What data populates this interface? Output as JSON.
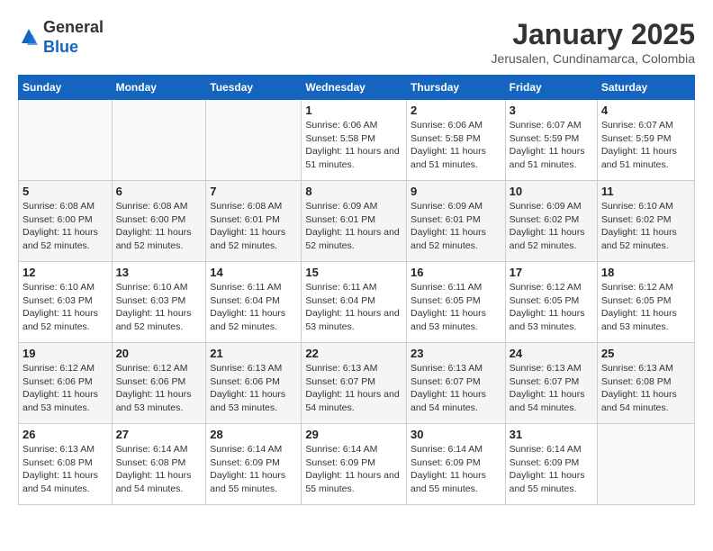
{
  "logo": {
    "general": "General",
    "blue": "Blue"
  },
  "title": "January 2025",
  "subtitle": "Jerusalen, Cundinamarca, Colombia",
  "days_of_week": [
    "Sunday",
    "Monday",
    "Tuesday",
    "Wednesday",
    "Thursday",
    "Friday",
    "Saturday"
  ],
  "weeks": [
    [
      {
        "day": "",
        "sunrise": "",
        "sunset": "",
        "daylight": ""
      },
      {
        "day": "",
        "sunrise": "",
        "sunset": "",
        "daylight": ""
      },
      {
        "day": "",
        "sunrise": "",
        "sunset": "",
        "daylight": ""
      },
      {
        "day": "1",
        "sunrise": "Sunrise: 6:06 AM",
        "sunset": "Sunset: 5:58 PM",
        "daylight": "Daylight: 11 hours and 51 minutes."
      },
      {
        "day": "2",
        "sunrise": "Sunrise: 6:06 AM",
        "sunset": "Sunset: 5:58 PM",
        "daylight": "Daylight: 11 hours and 51 minutes."
      },
      {
        "day": "3",
        "sunrise": "Sunrise: 6:07 AM",
        "sunset": "Sunset: 5:59 PM",
        "daylight": "Daylight: 11 hours and 51 minutes."
      },
      {
        "day": "4",
        "sunrise": "Sunrise: 6:07 AM",
        "sunset": "Sunset: 5:59 PM",
        "daylight": "Daylight: 11 hours and 51 minutes."
      }
    ],
    [
      {
        "day": "5",
        "sunrise": "Sunrise: 6:08 AM",
        "sunset": "Sunset: 6:00 PM",
        "daylight": "Daylight: 11 hours and 52 minutes."
      },
      {
        "day": "6",
        "sunrise": "Sunrise: 6:08 AM",
        "sunset": "Sunset: 6:00 PM",
        "daylight": "Daylight: 11 hours and 52 minutes."
      },
      {
        "day": "7",
        "sunrise": "Sunrise: 6:08 AM",
        "sunset": "Sunset: 6:01 PM",
        "daylight": "Daylight: 11 hours and 52 minutes."
      },
      {
        "day": "8",
        "sunrise": "Sunrise: 6:09 AM",
        "sunset": "Sunset: 6:01 PM",
        "daylight": "Daylight: 11 hours and 52 minutes."
      },
      {
        "day": "9",
        "sunrise": "Sunrise: 6:09 AM",
        "sunset": "Sunset: 6:01 PM",
        "daylight": "Daylight: 11 hours and 52 minutes."
      },
      {
        "day": "10",
        "sunrise": "Sunrise: 6:09 AM",
        "sunset": "Sunset: 6:02 PM",
        "daylight": "Daylight: 11 hours and 52 minutes."
      },
      {
        "day": "11",
        "sunrise": "Sunrise: 6:10 AM",
        "sunset": "Sunset: 6:02 PM",
        "daylight": "Daylight: 11 hours and 52 minutes."
      }
    ],
    [
      {
        "day": "12",
        "sunrise": "Sunrise: 6:10 AM",
        "sunset": "Sunset: 6:03 PM",
        "daylight": "Daylight: 11 hours and 52 minutes."
      },
      {
        "day": "13",
        "sunrise": "Sunrise: 6:10 AM",
        "sunset": "Sunset: 6:03 PM",
        "daylight": "Daylight: 11 hours and 52 minutes."
      },
      {
        "day": "14",
        "sunrise": "Sunrise: 6:11 AM",
        "sunset": "Sunset: 6:04 PM",
        "daylight": "Daylight: 11 hours and 52 minutes."
      },
      {
        "day": "15",
        "sunrise": "Sunrise: 6:11 AM",
        "sunset": "Sunset: 6:04 PM",
        "daylight": "Daylight: 11 hours and 53 minutes."
      },
      {
        "day": "16",
        "sunrise": "Sunrise: 6:11 AM",
        "sunset": "Sunset: 6:05 PM",
        "daylight": "Daylight: 11 hours and 53 minutes."
      },
      {
        "day": "17",
        "sunrise": "Sunrise: 6:12 AM",
        "sunset": "Sunset: 6:05 PM",
        "daylight": "Daylight: 11 hours and 53 minutes."
      },
      {
        "day": "18",
        "sunrise": "Sunrise: 6:12 AM",
        "sunset": "Sunset: 6:05 PM",
        "daylight": "Daylight: 11 hours and 53 minutes."
      }
    ],
    [
      {
        "day": "19",
        "sunrise": "Sunrise: 6:12 AM",
        "sunset": "Sunset: 6:06 PM",
        "daylight": "Daylight: 11 hours and 53 minutes."
      },
      {
        "day": "20",
        "sunrise": "Sunrise: 6:12 AM",
        "sunset": "Sunset: 6:06 PM",
        "daylight": "Daylight: 11 hours and 53 minutes."
      },
      {
        "day": "21",
        "sunrise": "Sunrise: 6:13 AM",
        "sunset": "Sunset: 6:06 PM",
        "daylight": "Daylight: 11 hours and 53 minutes."
      },
      {
        "day": "22",
        "sunrise": "Sunrise: 6:13 AM",
        "sunset": "Sunset: 6:07 PM",
        "daylight": "Daylight: 11 hours and 54 minutes."
      },
      {
        "day": "23",
        "sunrise": "Sunrise: 6:13 AM",
        "sunset": "Sunset: 6:07 PM",
        "daylight": "Daylight: 11 hours and 54 minutes."
      },
      {
        "day": "24",
        "sunrise": "Sunrise: 6:13 AM",
        "sunset": "Sunset: 6:07 PM",
        "daylight": "Daylight: 11 hours and 54 minutes."
      },
      {
        "day": "25",
        "sunrise": "Sunrise: 6:13 AM",
        "sunset": "Sunset: 6:08 PM",
        "daylight": "Daylight: 11 hours and 54 minutes."
      }
    ],
    [
      {
        "day": "26",
        "sunrise": "Sunrise: 6:13 AM",
        "sunset": "Sunset: 6:08 PM",
        "daylight": "Daylight: 11 hours and 54 minutes."
      },
      {
        "day": "27",
        "sunrise": "Sunrise: 6:14 AM",
        "sunset": "Sunset: 6:08 PM",
        "daylight": "Daylight: 11 hours and 54 minutes."
      },
      {
        "day": "28",
        "sunrise": "Sunrise: 6:14 AM",
        "sunset": "Sunset: 6:09 PM",
        "daylight": "Daylight: 11 hours and 55 minutes."
      },
      {
        "day": "29",
        "sunrise": "Sunrise: 6:14 AM",
        "sunset": "Sunset: 6:09 PM",
        "daylight": "Daylight: 11 hours and 55 minutes."
      },
      {
        "day": "30",
        "sunrise": "Sunrise: 6:14 AM",
        "sunset": "Sunset: 6:09 PM",
        "daylight": "Daylight: 11 hours and 55 minutes."
      },
      {
        "day": "31",
        "sunrise": "Sunrise: 6:14 AM",
        "sunset": "Sunset: 6:09 PM",
        "daylight": "Daylight: 11 hours and 55 minutes."
      },
      {
        "day": "",
        "sunrise": "",
        "sunset": "",
        "daylight": ""
      }
    ]
  ]
}
